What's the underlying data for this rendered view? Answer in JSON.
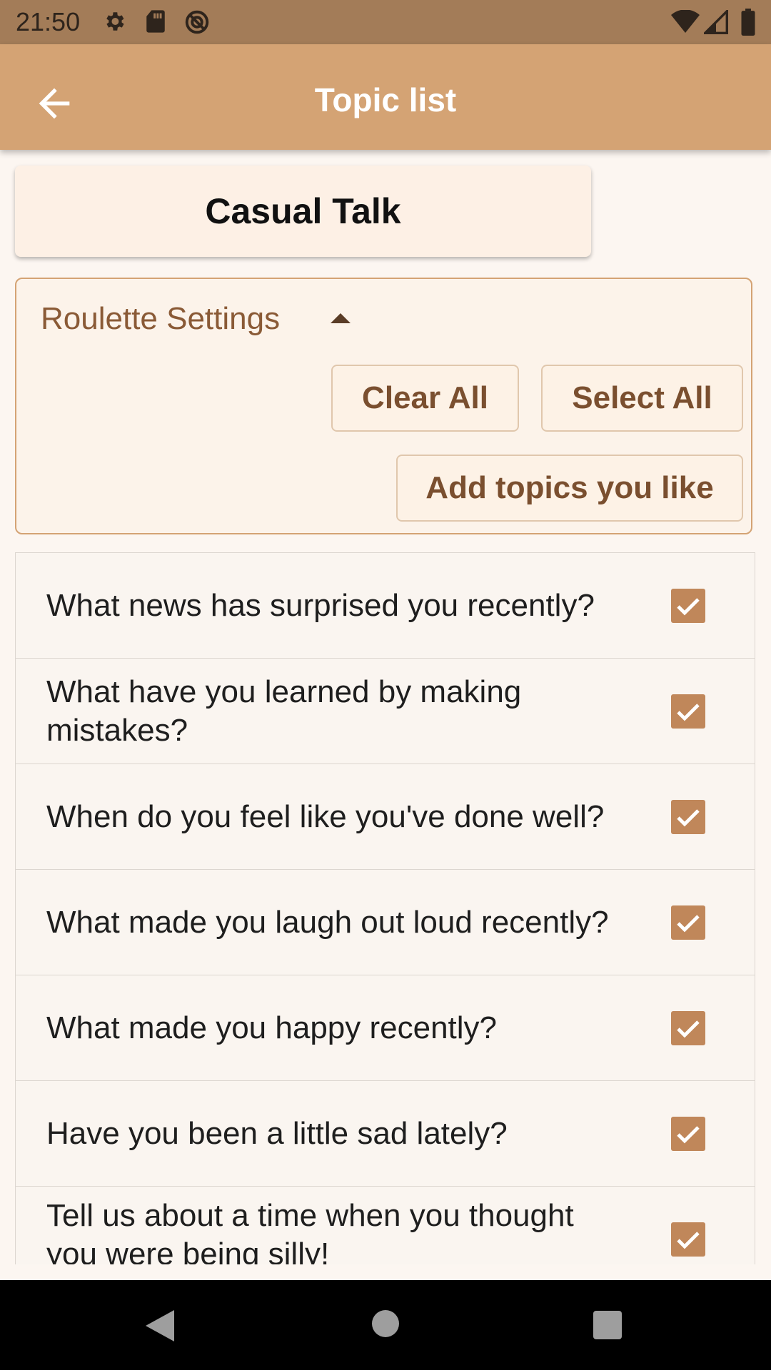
{
  "status_bar": {
    "time": "21:50",
    "icons": [
      "settings-icon",
      "sd-card-icon",
      "do-not-disturb-icon",
      "wifi-icon",
      "signal-icon",
      "battery-icon"
    ]
  },
  "app_bar": {
    "title": "Topic list",
    "back_icon": "arrow-back-icon",
    "background": "#d4a374"
  },
  "category": {
    "label": "Casual Talk"
  },
  "settings": {
    "title": "Roulette Settings",
    "toggle_icon": "arrow-up-icon",
    "clear_all_label": "Clear All",
    "select_all_label": "Select All",
    "add_topics_label": "Add topics you like"
  },
  "topics": [
    {
      "text": "What news has surprised you recently?",
      "checked": true
    },
    {
      "text": "What have you learned by making mistakes?",
      "checked": true
    },
    {
      "text": "When do you feel like you've done well?",
      "checked": true
    },
    {
      "text": "What made you laugh out loud recently?",
      "checked": true
    },
    {
      "text": "What made you happy recently?",
      "checked": true
    },
    {
      "text": "Have you been a little sad lately?",
      "checked": true
    },
    {
      "text": "Tell us about a time when you thought you were being silly!",
      "checked": true
    }
  ],
  "colors": {
    "accent": "#d4a374",
    "checkbox": "#c0875a",
    "settings_text": "#8a5a36",
    "button_text": "#7a4f2f"
  },
  "nav_bar": {
    "icons": [
      "nav-back-icon",
      "nav-home-icon",
      "nav-recents-icon"
    ]
  }
}
